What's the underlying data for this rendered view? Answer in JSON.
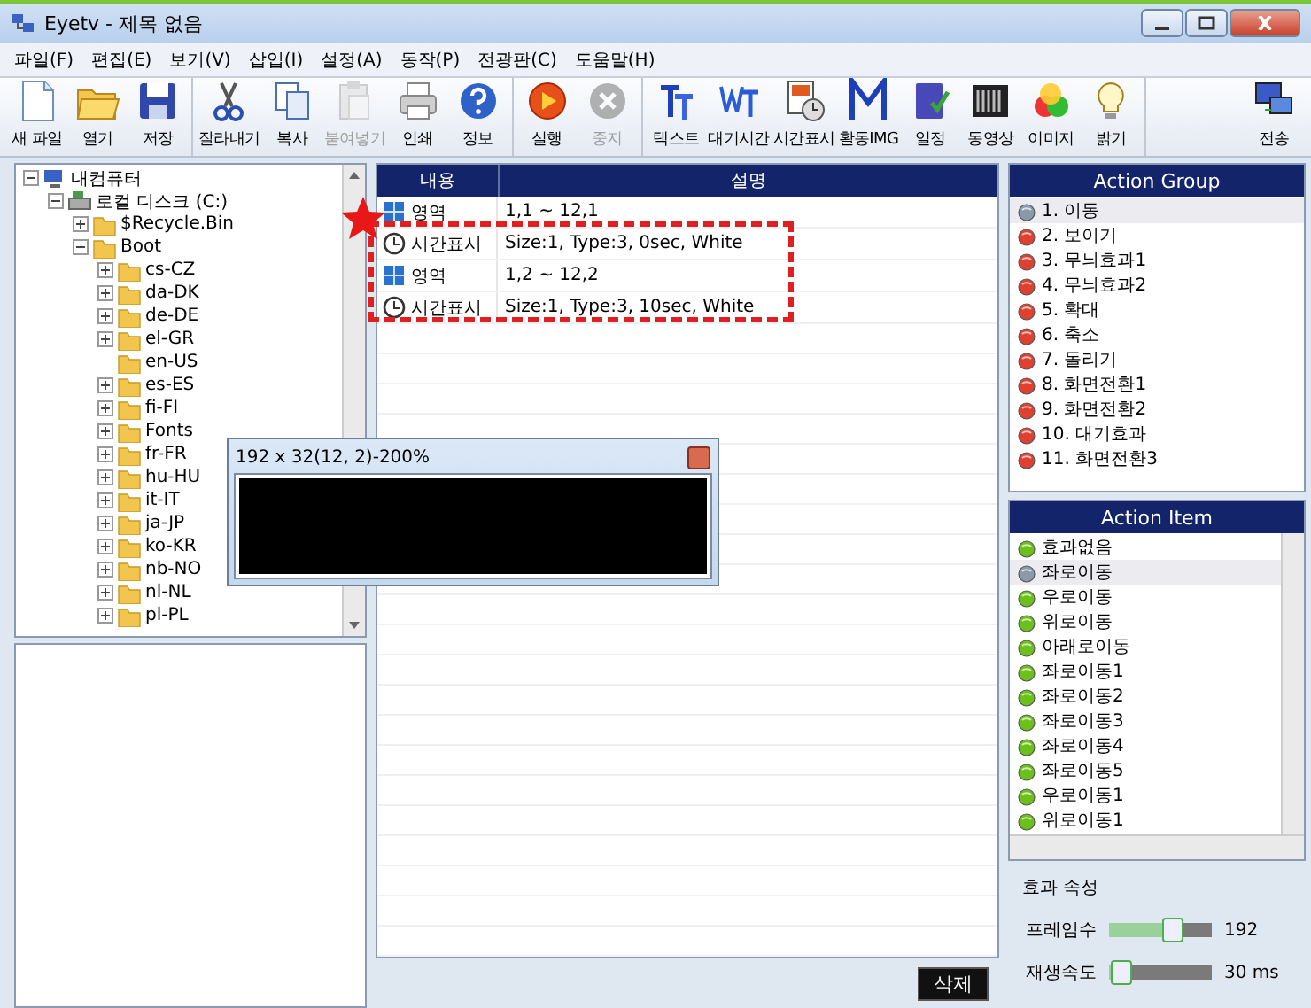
{
  "window": {
    "title": "Eyetv - 제목 없음"
  },
  "menu": [
    {
      "label": "파일(F)"
    },
    {
      "label": "편집(E)"
    },
    {
      "label": "보기(V)"
    },
    {
      "label": "삽입(I)"
    },
    {
      "label": "설정(A)"
    },
    {
      "label": "동작(P)"
    },
    {
      "label": "전광판(C)"
    },
    {
      "label": "도움말(H)"
    }
  ],
  "toolbar": [
    [
      {
        "kind": "new",
        "label": "새 파일",
        "disabled": false
      },
      {
        "kind": "open",
        "label": "열기",
        "disabled": false
      },
      {
        "kind": "save",
        "label": "저장",
        "disabled": false
      }
    ],
    [
      {
        "kind": "cut",
        "label": "잘라내기",
        "disabled": false
      },
      {
        "kind": "copy",
        "label": "복사",
        "disabled": false
      },
      {
        "kind": "paste",
        "label": "붙여넣기",
        "disabled": true
      },
      {
        "kind": "print",
        "label": "인쇄",
        "disabled": false
      },
      {
        "kind": "info",
        "label": "정보",
        "disabled": false
      }
    ],
    [
      {
        "kind": "run",
        "label": "실행",
        "disabled": false
      },
      {
        "kind": "stop",
        "label": "중지",
        "disabled": true
      }
    ],
    [
      {
        "kind": "text",
        "label": "텍스트",
        "disabled": false
      },
      {
        "kind": "wait",
        "label": "대기시간",
        "disabled": false
      },
      {
        "kind": "time",
        "label": "시간표시",
        "disabled": false
      },
      {
        "kind": "img",
        "label": "활동IMG",
        "disabled": false
      },
      {
        "kind": "schedule",
        "label": "일정",
        "disabled": false
      },
      {
        "kind": "video",
        "label": "동영상",
        "disabled": false
      },
      {
        "kind": "image",
        "label": "이미지",
        "disabled": false
      },
      {
        "kind": "bright",
        "label": "밝기",
        "disabled": false
      }
    ],
    [
      {
        "kind": "send",
        "label": "전송",
        "disabled": false
      }
    ]
  ],
  "tree": [
    {
      "kind": "computer",
      "label": "내컴퓨터",
      "expanded": true,
      "children": [
        {
          "kind": "disk",
          "label": "로컬 디스크 (C:)",
          "expanded": true,
          "children": [
            {
              "kind": "folder",
              "label": "$Recycle.Bin",
              "expanded": false
            },
            {
              "kind": "folder",
              "label": "Boot",
              "expanded": true,
              "children": [
                {
                  "kind": "folder",
                  "label": "cs-CZ",
                  "expanded": false
                },
                {
                  "kind": "folder",
                  "label": "da-DK",
                  "expanded": false
                },
                {
                  "kind": "folder",
                  "label": "de-DE",
                  "expanded": false
                },
                {
                  "kind": "folder",
                  "label": "el-GR",
                  "expanded": false
                },
                {
                  "kind": "folder",
                  "label": "en-US"
                },
                {
                  "kind": "folder",
                  "label": "es-ES",
                  "expanded": false
                },
                {
                  "kind": "folder",
                  "label": "fi-FI",
                  "expanded": false
                },
                {
                  "kind": "folder",
                  "label": "Fonts",
                  "expanded": false
                },
                {
                  "kind": "folder",
                  "label": "fr-FR",
                  "expanded": false
                },
                {
                  "kind": "folder",
                  "label": "hu-HU",
                  "expanded": false
                },
                {
                  "kind": "folder",
                  "label": "it-IT",
                  "expanded": false
                },
                {
                  "kind": "folder",
                  "label": "ja-JP",
                  "expanded": false
                },
                {
                  "kind": "folder",
                  "label": "ko-KR",
                  "expanded": false
                },
                {
                  "kind": "folder",
                  "label": "nb-NO",
                  "expanded": false
                },
                {
                  "kind": "folder",
                  "label": "nl-NL",
                  "expanded": false
                },
                {
                  "kind": "folder",
                  "label": "pl-PL",
                  "expanded": false
                }
              ]
            }
          ]
        }
      ]
    }
  ],
  "table": {
    "columns": [
      "내용",
      "설명"
    ],
    "rows": [
      {
        "kind": "area",
        "content": "영역",
        "description": "1,1 ~ 12,1"
      },
      {
        "kind": "time",
        "content": "시간표시",
        "description": "Size:1, Type:3, 0sec, White"
      },
      {
        "kind": "area",
        "content": "영역",
        "description": "1,2 ~ 12,2"
      },
      {
        "kind": "time",
        "content": "시간표시",
        "description": "Size:1, Type:3, 10sec, White"
      }
    ]
  },
  "delete_button": "삭제",
  "popup": {
    "title": "192 x 32(12, 2)-200%"
  },
  "action_group": {
    "title": "Action Group",
    "items": [
      {
        "label": "1. 이동",
        "selected": true
      },
      {
        "label": "2. 보이기",
        "selected": false
      },
      {
        "label": "3. 무늬효과1",
        "selected": false
      },
      {
        "label": "4. 무늬효과2",
        "selected": false
      },
      {
        "label": "5. 확대",
        "selected": false
      },
      {
        "label": "6. 축소",
        "selected": false
      },
      {
        "label": "7. 돌리기",
        "selected": false
      },
      {
        "label": "8. 화면전환1",
        "selected": false
      },
      {
        "label": "9. 화면전환2",
        "selected": false
      },
      {
        "label": "10. 대기효과",
        "selected": false
      },
      {
        "label": "11. 화면전환3",
        "selected": false
      }
    ]
  },
  "action_item": {
    "title": "Action Item",
    "items": [
      {
        "label": "효과없음",
        "selected": false
      },
      {
        "label": "좌로이동",
        "selected": true
      },
      {
        "label": "우로이동",
        "selected": false
      },
      {
        "label": "위로이동",
        "selected": false
      },
      {
        "label": "아래로이동",
        "selected": false
      },
      {
        "label": "좌로이동1",
        "selected": false
      },
      {
        "label": "좌로이동2",
        "selected": false
      },
      {
        "label": "좌로이동3",
        "selected": false
      },
      {
        "label": "좌로이동4",
        "selected": false
      },
      {
        "label": "좌로이동5",
        "selected": false
      },
      {
        "label": "우로이동1",
        "selected": false
      },
      {
        "label": "위로이동1",
        "selected": false
      }
    ]
  },
  "effect_properties": {
    "title": "효과 속성",
    "sliders": [
      {
        "label": "프레임수",
        "level": 0.62,
        "reading": "192"
      },
      {
        "label": "재생속도",
        "level": 0.12,
        "reading": "30 ms"
      }
    ]
  }
}
